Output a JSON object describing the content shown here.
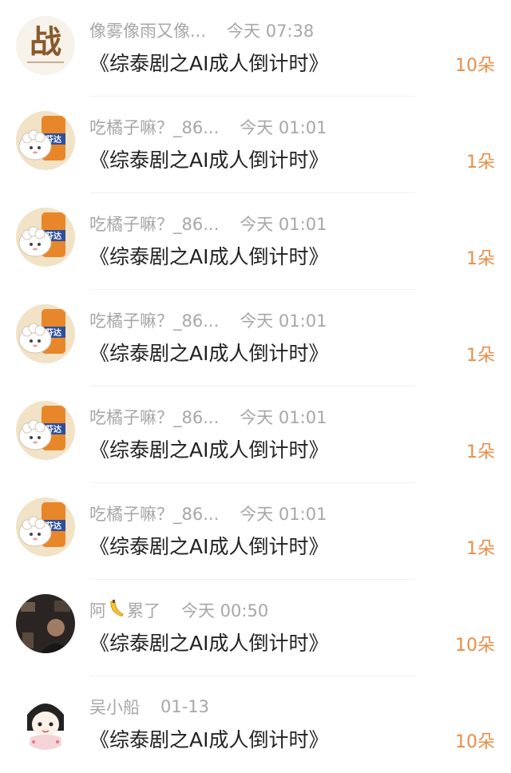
{
  "items": [
    {
      "name": "像雾像雨又像...",
      "time": "今天 07:38",
      "title": "《综泰剧之AI成人倒计时》",
      "gift": "10朵",
      "avatar": "calligraphy-avatar"
    },
    {
      "name": "吃橘子嘛？_86...",
      "time": "今天 01:01",
      "title": "《综泰剧之AI成人倒计时》",
      "gift": "1朵",
      "avatar": "sheep-soda-avatar"
    },
    {
      "name": "吃橘子嘛？_86...",
      "time": "今天 01:01",
      "title": "《综泰剧之AI成人倒计时》",
      "gift": "1朵",
      "avatar": "sheep-soda-avatar"
    },
    {
      "name": "吃橘子嘛？_86...",
      "time": "今天 01:01",
      "title": "《综泰剧之AI成人倒计时》",
      "gift": "1朵",
      "avatar": "sheep-soda-avatar"
    },
    {
      "name": "吃橘子嘛？_86...",
      "time": "今天 01:01",
      "title": "《综泰剧之AI成人倒计时》",
      "gift": "1朵",
      "avatar": "sheep-soda-avatar"
    },
    {
      "name": "吃橘子嘛？_86...",
      "time": "今天 01:01",
      "title": "《综泰剧之AI成人倒计时》",
      "gift": "1朵",
      "avatar": "sheep-soda-avatar"
    },
    {
      "name_before": "阿",
      "name_after": "累了",
      "time": "今天 00:50",
      "title": "《综泰剧之AI成人倒计时》",
      "gift": "10朵",
      "avatar": "dark-photo-avatar"
    },
    {
      "name": "吴小船",
      "time": "01-13",
      "title": "《综泰剧之AI成人倒计时》",
      "gift": "10朵",
      "avatar": "cartoon-girl-avatar"
    }
  ],
  "avatar_text": {
    "calligraphy": "战",
    "soda_label": "芬达"
  },
  "colors": {
    "meta_gray": "#a7a7a7",
    "title_dark": "#222222",
    "gift_orange": "#e98d46"
  }
}
